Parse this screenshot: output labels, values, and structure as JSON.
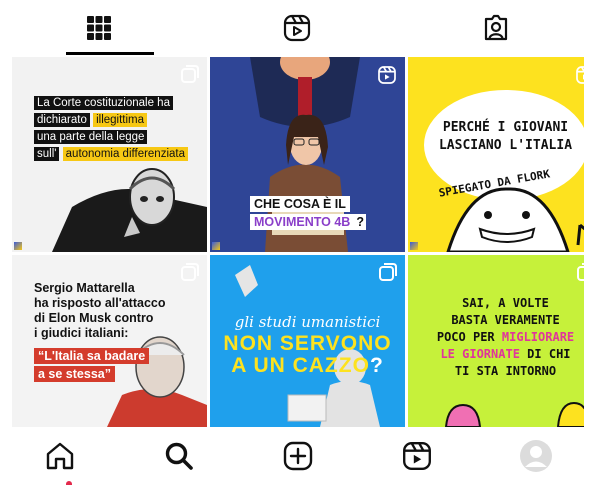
{
  "tabs": [
    {
      "icon": "grid-icon"
    },
    {
      "icon": "reels-icon"
    },
    {
      "icon": "tagged-icon"
    }
  ],
  "posts": [
    {
      "lines": [
        "La Corte costituzionale ha",
        "dichiarato",
        "illegittima",
        "una parte della legge",
        "sull'",
        "autonomia differenziata"
      ]
    },
    {
      "line1": "CHE COSA È IL",
      "line2": "MOVIMENTO 4B",
      "q": "?"
    },
    {
      "title": [
        "PERCHÉ I GIOVANI",
        "LASCIANO L'ITALIA"
      ],
      "sub": "SPIEGATO DA FLORK"
    },
    {
      "lines": [
        "Sergio Mattarella",
        "ha risposto all'attacco",
        "di Elon Musk contro",
        "i giudici italiani:"
      ],
      "quote1": "“L'Italia sa badare",
      "quote2": "a se stessa”"
    },
    {
      "line1": "gli studi umanistici",
      "line2": "NON SERVONO",
      "line3": "A UN CAZZO",
      "q": "?"
    },
    {
      "lines": [
        "SAI, A VOLTE",
        "BASTA VERAMENTE",
        "POCO PER",
        "MIGLIORARE",
        "LE GIORNATE",
        "DI CHI",
        "TI STA INTORNO"
      ]
    }
  ],
  "colors": {
    "yellow": "#fde21f",
    "lime": "#c6f13a",
    "blue": "#1fa0ec",
    "purple": "#8a3ec9",
    "pink": "#e0359b",
    "red": "#d43c2c"
  },
  "bottom_nav": [
    {
      "icon": "home-icon"
    },
    {
      "icon": "search-icon"
    },
    {
      "icon": "create-icon"
    },
    {
      "icon": "reels-icon"
    },
    {
      "icon": "profile-avatar"
    }
  ]
}
